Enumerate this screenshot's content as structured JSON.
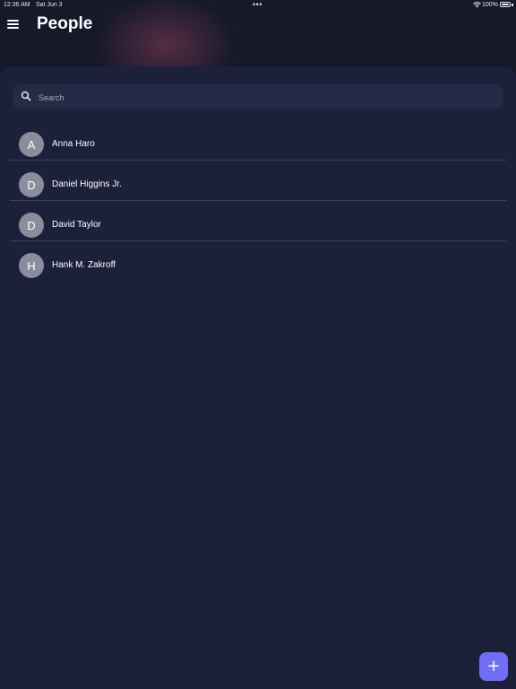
{
  "status_bar": {
    "time": "12:36 AM",
    "date": "Sat Jun 3",
    "dots": "•••",
    "battery": "100%"
  },
  "header": {
    "title": "People",
    "menu_icon": "hamburger-menu-icon"
  },
  "search": {
    "placeholder": "Search",
    "value": "",
    "icon": "search-icon"
  },
  "contacts": [
    {
      "initial": "A",
      "name": "Anna Haro"
    },
    {
      "initial": "D",
      "name": "Daniel Higgins Jr."
    },
    {
      "initial": "D",
      "name": "David Taylor"
    },
    {
      "initial": "H",
      "name": "Hank M. Zakroff"
    }
  ],
  "fab": {
    "label": "+",
    "icon": "add-icon"
  },
  "colors": {
    "background": "#1d2039",
    "search_bg": "#262a47",
    "avatar_bg": "#8c8d9c",
    "accent": "#6f6ef5"
  }
}
